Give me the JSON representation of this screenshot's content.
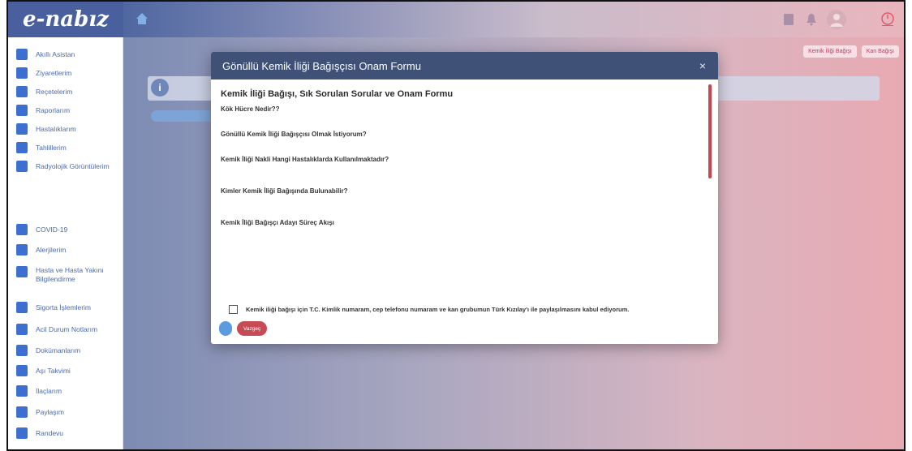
{
  "app": {
    "logo_text": "e-nabız",
    "logo_subtitle": "",
    "home_icon": "home-icon",
    "top_icons": [
      "document-icon",
      "bell-icon",
      "user-avatar-icon",
      "globe-icon",
      "logout-icon"
    ]
  },
  "sidebar": {
    "items_top": [
      {
        "label": "Akıllı Asistan",
        "icon": "assistant-icon"
      },
      {
        "label": "Ziyaretlerim",
        "icon": "building-icon"
      },
      {
        "label": "Reçetelerim",
        "icon": "prescription-icon"
      },
      {
        "label": "Raporlarım",
        "icon": "report-icon"
      },
      {
        "label": "Hastalıklarım",
        "icon": "disease-icon"
      },
      {
        "label": "Tahlillerim",
        "icon": "lab-tests-icon"
      },
      {
        "label": "Radyolojik Görüntülerim",
        "icon": "radiology-icon"
      }
    ],
    "section_label": "",
    "items_bottom": [
      {
        "label": "COVID-19",
        "icon": "virus-icon"
      },
      {
        "label": "Alerjilerim",
        "icon": "allergy-icon"
      },
      {
        "label": "Hasta ve Hasta Yakını Bilgilendirme",
        "icon": "info-icon"
      },
      {
        "label": "Sigorta İşlemlerim",
        "icon": "insurance-icon"
      },
      {
        "label": "Acil Durum Notlarım",
        "icon": "emergency-notes-icon"
      },
      {
        "label": "Dokümanlarım",
        "icon": "documents-icon"
      },
      {
        "label": "Aşı Takvimi",
        "icon": "vaccine-icon"
      },
      {
        "label": "İlaçlarım",
        "icon": "pills-icon"
      },
      {
        "label": "Paylaşım",
        "icon": "share-icon"
      },
      {
        "label": "Randevu",
        "icon": "appointment-icon"
      }
    ]
  },
  "background": {
    "right_links": [
      "Kemik İliği Bağışı",
      "Kan Bağışı"
    ],
    "banner_text": "",
    "add_button_label": ""
  },
  "modal": {
    "title": "Gönüllü Kemik İliği Bağışçısı Onam Formu",
    "close_label": "×",
    "doc_title": "Kemik İliği Bağışı, Sık Sorulan Sorular ve Onam Formu",
    "sections": [
      {
        "title": "Kök Hücre Nedir??",
        "body": ""
      },
      {
        "title": "Gönüllü Kemik İliği Bağışçısı Olmak İstiyorum?",
        "body": ""
      },
      {
        "title": "Kemik İliği Nakli Hangi Hastalıklarda Kullanılmaktadır?",
        "body": ""
      },
      {
        "title": "Kimler Kemik İliği Bağışında Bulunabilir?",
        "body": ""
      },
      {
        "title": "Kemik İliği Bağışçı Adayı Süreç Akışı",
        "body": ""
      }
    ],
    "steps": [
      "",
      ""
    ],
    "consent_text": "Kemik iliği bağışı için T.C. Kimlik numaram, cep telefonu numaram ve kan grubumun Türk Kızılay'ı ile paylaşılmasını kabul ediyorum.",
    "consent_checked": false,
    "primary_button": "",
    "cancel_button": "Vazgeç"
  },
  "colors": {
    "modal_header": "#3f5176",
    "primary": "#5b9be0",
    "danger": "#c74b55",
    "sidebar_text": "#4a6aa8"
  }
}
